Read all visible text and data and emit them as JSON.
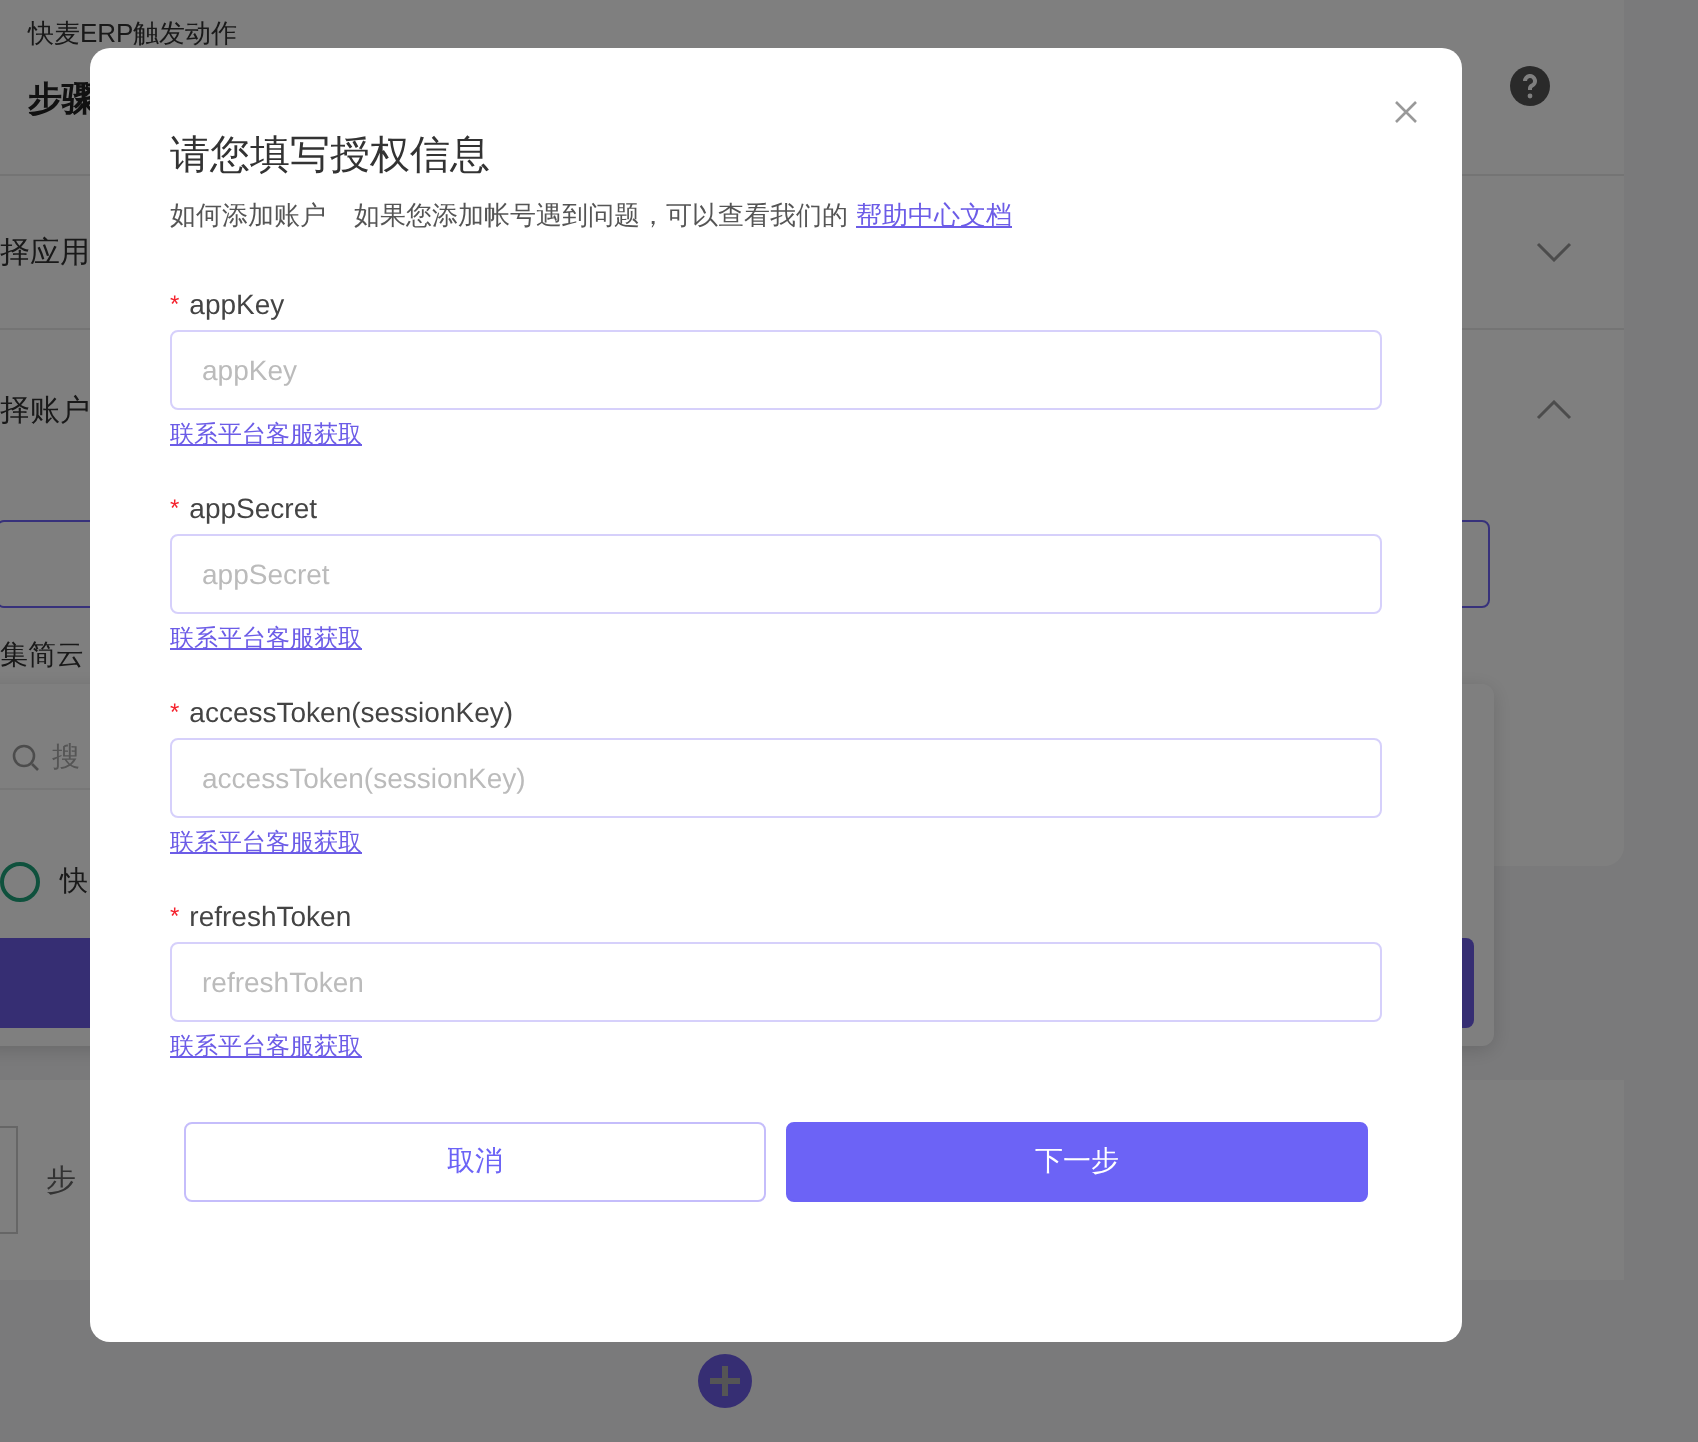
{
  "background": {
    "header_title": "快麦ERP触发动作",
    "step_label": "步骤",
    "sections": [
      {
        "label": "择应用",
        "expanded": false
      },
      {
        "label": "择账户",
        "expanded": true
      }
    ],
    "selected_app": "集简云",
    "search_placeholder": "搜",
    "account": {
      "label": "快",
      "selected": false
    },
    "next_step": "步"
  },
  "dialog": {
    "title": "请您填写授权信息",
    "how_to": "如何添加账户",
    "subtitle": "如果您添加帐号遇到问题，可以查看我们的",
    "help_link": "帮助中心文档",
    "required_mark": "*",
    "fields": [
      {
        "label": "appKey",
        "required": true,
        "placeholder": "appKey",
        "hint_link": "联系平台客服获取"
      },
      {
        "label": "appSecret",
        "required": true,
        "placeholder": "appSecret",
        "hint_link": "联系平台客服获取"
      },
      {
        "label": "accessToken(sessionKey)",
        "required": true,
        "placeholder": "accessToken(sessionKey)",
        "hint_link": "联系平台客服获取"
      },
      {
        "label": "refreshToken",
        "required": true,
        "placeholder": "refreshToken",
        "hint_link": "联系平台客服获取"
      }
    ],
    "buttons": [
      {
        "label": "取消",
        "kind": "secondary"
      },
      {
        "label": "下一步",
        "kind": "primary"
      }
    ]
  }
}
